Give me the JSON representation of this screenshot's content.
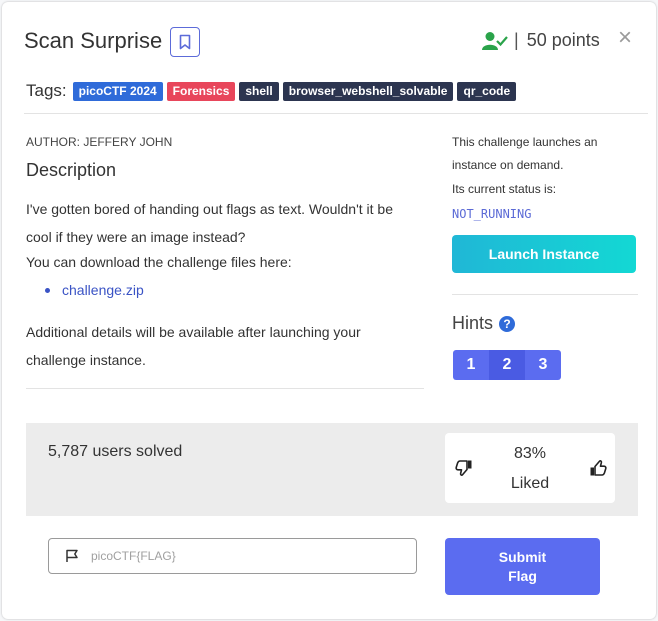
{
  "challenge": {
    "title": "Scan Surprise",
    "points_sep": "|",
    "points": "50 points",
    "close_glyph": "×"
  },
  "tags": {
    "label": "Tags:",
    "items": [
      {
        "text": "picoCTF 2024",
        "color": "#2f6bd9"
      },
      {
        "text": "Forensics",
        "color": "#e8465b"
      },
      {
        "text": "shell",
        "color": "#2c3550"
      },
      {
        "text": "browser_webshell_solvable",
        "color": "#2c3550"
      },
      {
        "text": "qr_code",
        "color": "#2c3550"
      }
    ]
  },
  "description": {
    "author": "AUTHOR: JEFFERY JOHN",
    "heading": "Description",
    "line1": "I've gotten bored of handing out flags as text. Wouldn't it be cool if they were an image instead?",
    "line2": "You can download the challenge files here:",
    "link": "challenge.zip",
    "note": "Additional details will be available after launching your challenge instance."
  },
  "instance": {
    "line1": "This challenge launches an",
    "line2": "instance on demand.",
    "line3": "Its current status is:",
    "status": "NOT_RUNNING",
    "launch_label": "Launch Instance"
  },
  "hints": {
    "heading": "Hints",
    "help_glyph": "?",
    "buttons": [
      "1",
      "2",
      "3"
    ]
  },
  "stats": {
    "solved": "5,787 users solved",
    "liked_pct": "83%",
    "liked_label": "Liked"
  },
  "submit": {
    "placeholder": "picoCTF{FLAG}",
    "label_line1": "Submit",
    "label_line2": "Flag"
  },
  "colors": {
    "accent": "#5b6cf0",
    "launch": "#13c8d6",
    "solved_icon": "#2aa34a"
  },
  "icons": {
    "bookmark": "bookmark-icon",
    "solved": "user-check-icon",
    "close": "close-icon",
    "dislike": "thumbs-down-icon",
    "like": "thumbs-up-icon",
    "flag": "flag-icon"
  }
}
